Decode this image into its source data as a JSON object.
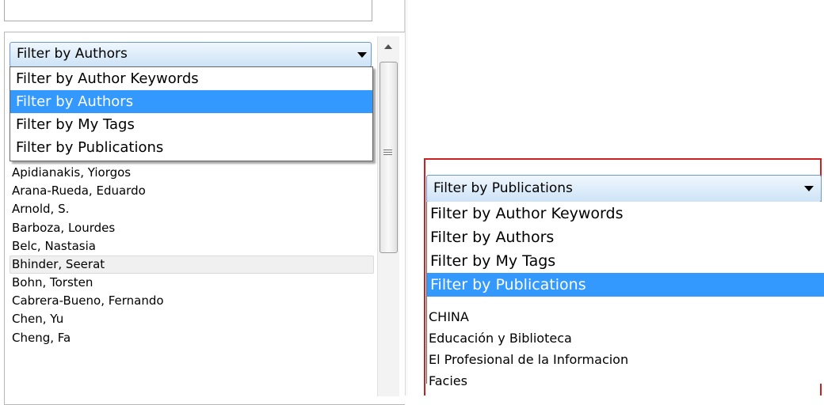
{
  "left_panel": {
    "filter_combo": {
      "selected": "Filter by Authors",
      "options": [
        "Filter by Author Keywords",
        "Filter by Authors",
        "Filter by My Tags",
        "Filter by Publications"
      ],
      "highlighted_index": 1
    },
    "names": [
      "Apidianakis, Yiorgos",
      "Arana-Rueda, Eduardo",
      "Arnold, S.",
      "Barboza, Lourdes",
      "Belc, Nastasia",
      "Bhinder, Seerat",
      "Bohn, Torsten",
      "Cabrera-Bueno, Fernando",
      "Chen, Yu",
      "Cheng, Fa"
    ],
    "selected_name_index": 5
  },
  "right_panel": {
    "filter_combo": {
      "selected": "Filter by Publications",
      "options": [
        "Filter by Author Keywords",
        "Filter by Authors",
        "Filter by My Tags",
        "Filter by Publications"
      ],
      "highlighted_index": 3
    },
    "publications": [
      "CHINA",
      "Educación y Biblioteca",
      "El Profesional de la Informacion",
      "Facies"
    ]
  },
  "colors": {
    "highlight": "#3399ff",
    "annotation_border": "#cc1f1f",
    "combo_border": "#6a9bd0"
  }
}
